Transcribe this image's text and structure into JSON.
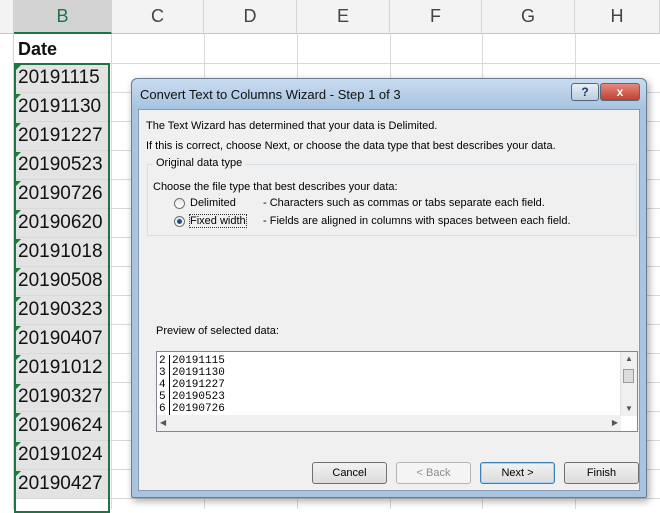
{
  "sheet": {
    "columns": [
      "B",
      "C",
      "D",
      "E",
      "F",
      "G",
      "H"
    ],
    "header_cell": "Date",
    "values": [
      "20191115",
      "20191130",
      "20191227",
      "20190523",
      "20190726",
      "20190620",
      "20191018",
      "20190508",
      "20190323",
      "20190407",
      "20191012",
      "20190327",
      "20190624",
      "20191024",
      "20190427"
    ]
  },
  "dialog": {
    "title": "Convert Text to Columns Wizard - Step 1 of 3",
    "help_icon": "?",
    "close_icon": "x",
    "intro1": "The Text Wizard has determined that your data is Delimited.",
    "intro2": "If this is correct, choose Next, or choose the data type that best describes your data.",
    "group_title": "Original data type",
    "choose_label": "Choose the file type that best describes your data:",
    "options": [
      {
        "label": "Delimited",
        "desc": "- Characters such as commas or tabs separate each field.",
        "selected": false
      },
      {
        "label": "Fixed width",
        "desc": "- Fields are aligned in columns with spaces between each field.",
        "selected": true
      }
    ],
    "preview_label": "Preview of selected data:",
    "preview_lines": [
      {
        "num": "2",
        "text": "20191115"
      },
      {
        "num": "3",
        "text": "20191130"
      },
      {
        "num": "4",
        "text": "20191227"
      },
      {
        "num": "5",
        "text": "20190523"
      },
      {
        "num": "6",
        "text": "20190726"
      }
    ],
    "buttons": {
      "cancel": "Cancel",
      "back": "< Back",
      "next": "Next >",
      "finish": "Finish"
    }
  }
}
